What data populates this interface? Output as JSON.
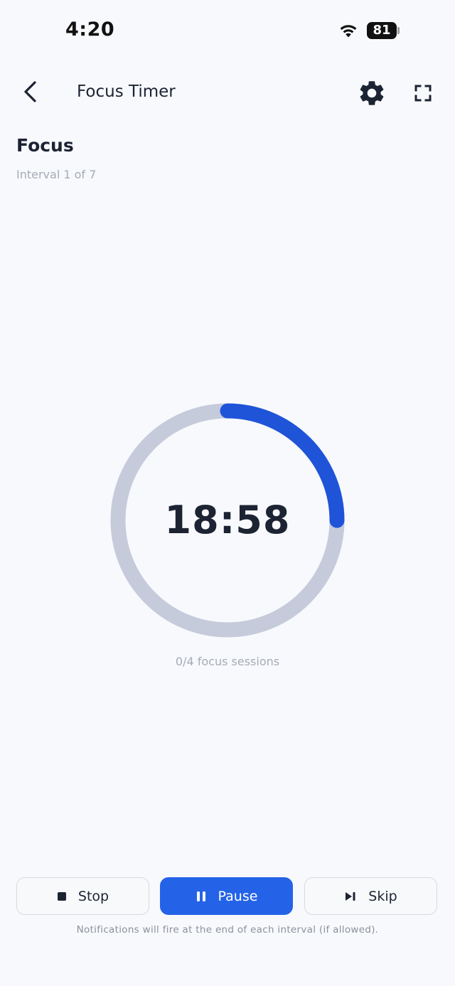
{
  "status_bar": {
    "time": "4:20",
    "battery": "81"
  },
  "header": {
    "title": "Focus Timer"
  },
  "session": {
    "title": "Focus",
    "subtitle": "Interval 1 of 7"
  },
  "timer": {
    "remaining": "18:58",
    "progress_fraction": 0.25,
    "progress_color": "#1f54d9",
    "track_color": "#c5cbdb",
    "sessions_label": "0/4 focus sessions"
  },
  "controls": {
    "stop_label": "Stop",
    "pause_label": "Pause",
    "skip_label": "Skip"
  },
  "footnote": "Notifications will fire at the end of each interval (if allowed).",
  "colors": {
    "primary": "#2463e8",
    "text": "#1c2333",
    "muted": "#a5abb6",
    "background": "#f8f9fc"
  },
  "icons": {
    "back": "chevron-left-icon",
    "settings": "gear-icon",
    "fullscreen": "fullscreen-icon",
    "stop": "stop-square-icon",
    "pause": "pause-icon",
    "skip": "skip-next-icon",
    "wifi": "wifi-icon"
  }
}
